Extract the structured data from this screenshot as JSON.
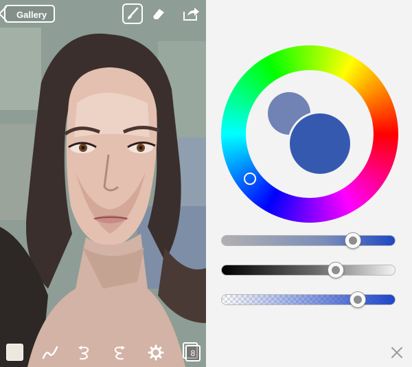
{
  "toolbar": {
    "gallery_label": "Gallery",
    "tools": [
      "brush-icon",
      "eraser-icon",
      "share-icon"
    ],
    "active_tool": "brush"
  },
  "bottom_tools": {
    "icons": [
      "color-swatch",
      "pen-stroke-icon",
      "undo-swirl-icon",
      "redo-swirl-icon",
      "gear-icon",
      "layers-icon"
    ],
    "layers_count": "8"
  },
  "color_picker": {
    "current_color": "#3659b0",
    "previous_color": "#7182b5",
    "saturation": 0.78,
    "brightness": 0.67,
    "opacity": 0.81
  }
}
